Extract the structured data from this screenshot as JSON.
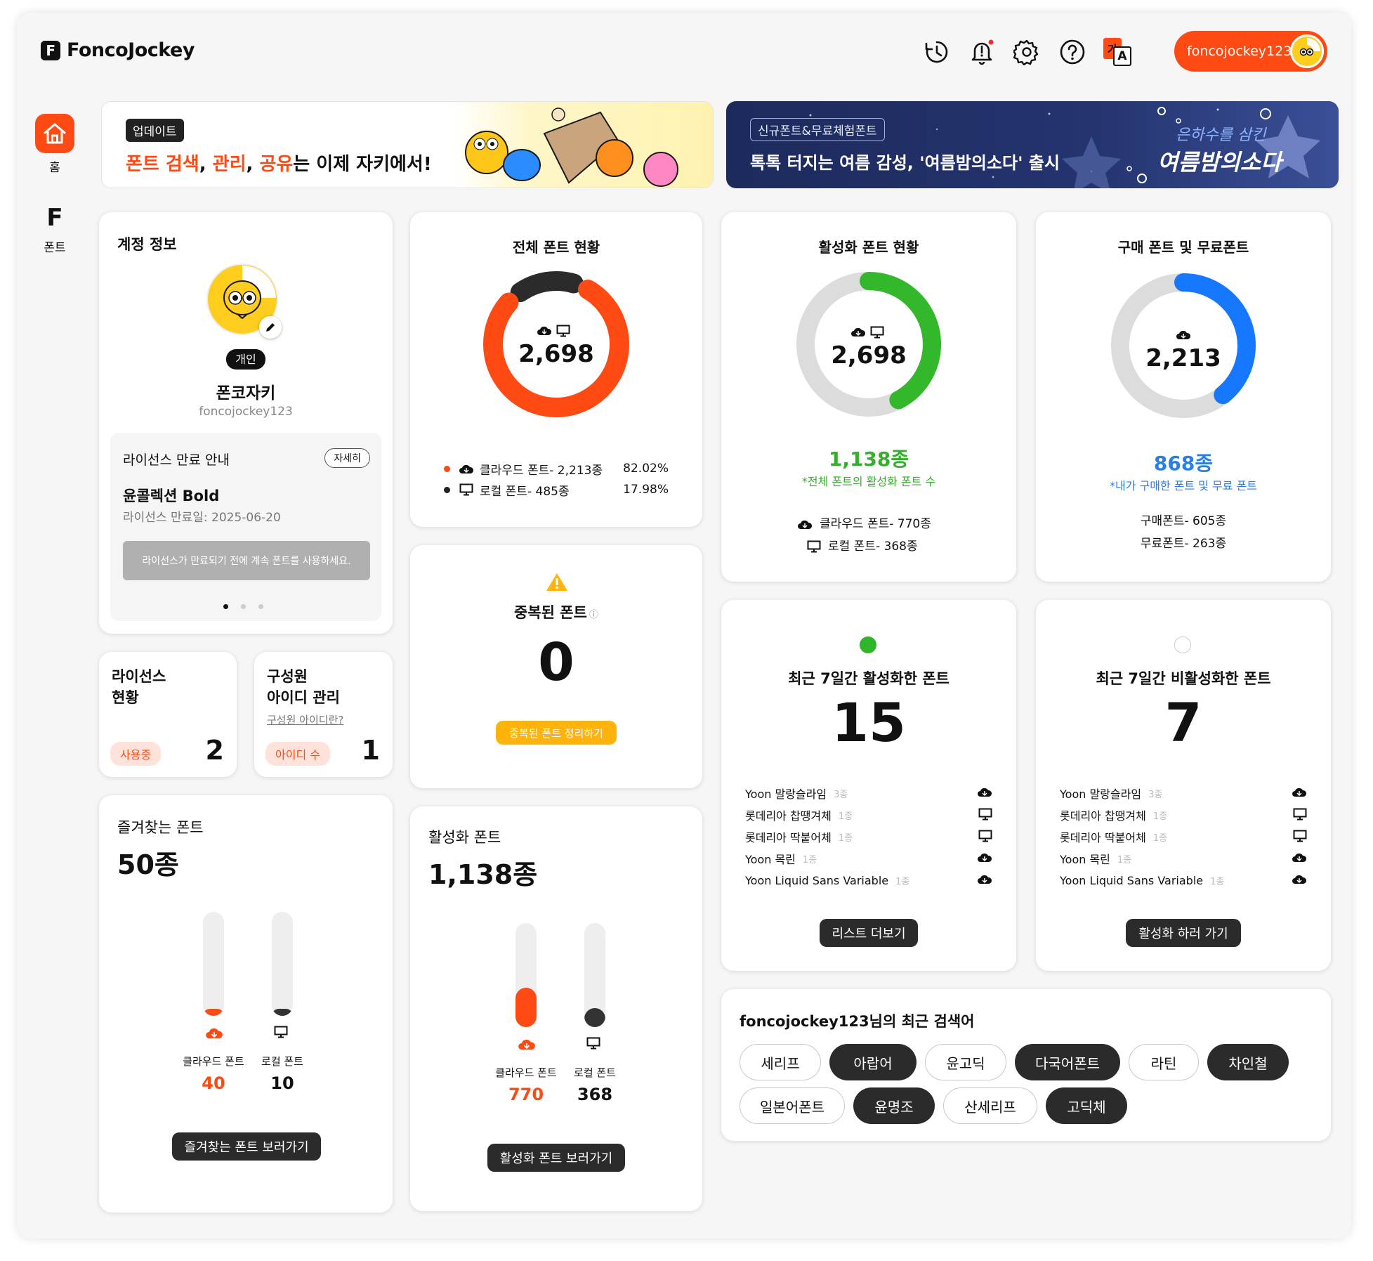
{
  "app": {
    "name": "FoncoJockey",
    "logo_letter": "F"
  },
  "topbar": {
    "icons": [
      "history-icon",
      "bell-icon",
      "gear-icon",
      "help-icon",
      "translate-icon"
    ],
    "translate_glyph": "가",
    "translate_glyph2": "A",
    "user": "foncojockey123"
  },
  "sidebar": {
    "home": "홈",
    "font": "폰트",
    "font_letter": "F"
  },
  "banner_update": {
    "tag": "업데이트",
    "text_parts": [
      "폰트 검색",
      ", ",
      "관리",
      ", ",
      "공유",
      "는 이제 자키에서!"
    ]
  },
  "banner_promo": {
    "tag": "신규폰트&무료체험폰트",
    "text": "톡톡 터지는 여름 감성, '여름밤의소다' 출시",
    "deco_line1": "은하수를 삼킨",
    "deco_line2": "여름밤의소다"
  },
  "account": {
    "title": "계정 정보",
    "badge": "개인",
    "name": "폰코자키",
    "id": "foncojockey123",
    "license_notice": {
      "title": "라이선스 만료 안내",
      "detail_btn": "자세히",
      "font": "윤콜렉션 Bold",
      "expiry_label": "라이선스 만료일: 2025-06-20",
      "action": "라이선스가 만료되기 전에 계속 폰트를 사용하세요."
    }
  },
  "license_status": {
    "title_l1": "라이선스",
    "title_l2": "현황",
    "badge": "사용중",
    "value": "2"
  },
  "members": {
    "title_l1": "구성원",
    "title_l2": "아이디 관리",
    "link": "구성원 아이디란?",
    "badge": "아이디 수",
    "value": "1"
  },
  "total_fonts": {
    "title": "전체 폰트 현황",
    "value": "2,698",
    "rows": [
      {
        "label": "클라우드 폰트- 2,213종",
        "pct": "82.02%",
        "dot": "#ff4a13"
      },
      {
        "label": "로컬 폰트- 485종",
        "pct": "17.98%",
        "dot": "#222222"
      }
    ]
  },
  "active_fonts": {
    "title": "활성화 폰트 현황",
    "value": "2,698",
    "count": "1,138종",
    "note": "*전체 폰트의 활성화 폰트 수",
    "rows": [
      "클라우드 폰트- 770종",
      "로컬 폰트- 368종"
    ]
  },
  "purchased_fonts": {
    "title": "구매 폰트 및 무료폰트",
    "value": "2,213",
    "count": "868종",
    "note": "*내가 구매한 폰트 및 무료 폰트",
    "rows": [
      "구매폰트- 605종",
      "무료폰트- 263종"
    ]
  },
  "duplicate": {
    "title": "중복된 폰트",
    "info": "ⓘ",
    "value": "0",
    "btn": "중복된 폰트 정리하기"
  },
  "recent_active": {
    "title": "최근 7일간 활성화한 폰트",
    "value": "15",
    "btn": "리스트 더보기",
    "items": [
      {
        "name": "Yoon 말랑슬라임",
        "count": "3종",
        "icon": "cloud-icon"
      },
      {
        "name": "롯데리아 찹땡겨체",
        "count": "1종",
        "icon": "monitor-icon"
      },
      {
        "name": "롯데리아 딱붙어체",
        "count": "1종",
        "icon": "monitor-icon"
      },
      {
        "name": "Yoon 목린",
        "count": "1종",
        "icon": "cloud-icon"
      },
      {
        "name": "Yoon Liquid Sans Variable",
        "count": "1종",
        "icon": "cloud-icon"
      }
    ]
  },
  "recent_inactive": {
    "title": "최근 7일간 비활성화한 폰트",
    "value": "7",
    "btn": "활성화 하러 가기",
    "items": [
      {
        "name": "Yoon 말랑슬라임",
        "count": "3종",
        "icon": "cloud-icon"
      },
      {
        "name": "롯데리아 찹땡겨체",
        "count": "1종",
        "icon": "monitor-icon"
      },
      {
        "name": "롯데리아 딱붙어체",
        "count": "1종",
        "icon": "monitor-icon"
      },
      {
        "name": "Yoon 목린",
        "count": "1종",
        "icon": "cloud-icon"
      },
      {
        "name": "Yoon Liquid Sans Variable",
        "count": "1종",
        "icon": "cloud-icon"
      }
    ]
  },
  "favorites": {
    "title": "즐겨찾는 폰트",
    "value": "50종",
    "btn": "즐겨찾는 폰트 보러가기",
    "bars": [
      {
        "label": "클라우드 폰트",
        "value": "40",
        "fraction": 0.07,
        "color": "#ff4a13"
      },
      {
        "label": "로컬 폰트",
        "value": "10",
        "fraction": 0.07,
        "color": "#333333"
      }
    ]
  },
  "active_summary": {
    "title": "활성화 폰트",
    "value": "1,138종",
    "btn": "활성화 폰트 보러가기",
    "bars": [
      {
        "label": "클라우드 폰트",
        "value": "770",
        "fraction": 0.38,
        "color": "#ff4a13"
      },
      {
        "label": "로컬 폰트",
        "value": "368",
        "fraction": 0.18,
        "color": "#333333"
      }
    ]
  },
  "searches": {
    "title": "foncojockey123님의 최근 검색어",
    "row1": [
      {
        "label": "세리프",
        "style": "light"
      },
      {
        "label": "아랍어",
        "style": "dark"
      },
      {
        "label": "윤고딕",
        "style": "light"
      },
      {
        "label": "다국어폰트",
        "style": "dark"
      },
      {
        "label": "라틴",
        "style": "light"
      },
      {
        "label": "차인철",
        "style": "dark"
      }
    ],
    "row2": [
      {
        "label": "일본어폰트",
        "style": "light"
      },
      {
        "label": "윤명조",
        "style": "dark"
      },
      {
        "label": "산세리프",
        "style": "light"
      },
      {
        "label": "고딕체",
        "style": "dark"
      }
    ]
  },
  "donut_values": {
    "total": {
      "cloud": 0.8202,
      "local": 0.1798
    },
    "active": 0.4218,
    "purchased": 0.3922
  },
  "colors": {
    "accent": "#ff4a13",
    "green": "#2fb52a",
    "blue": "#1677ff",
    "dark": "#2b2b2b"
  }
}
